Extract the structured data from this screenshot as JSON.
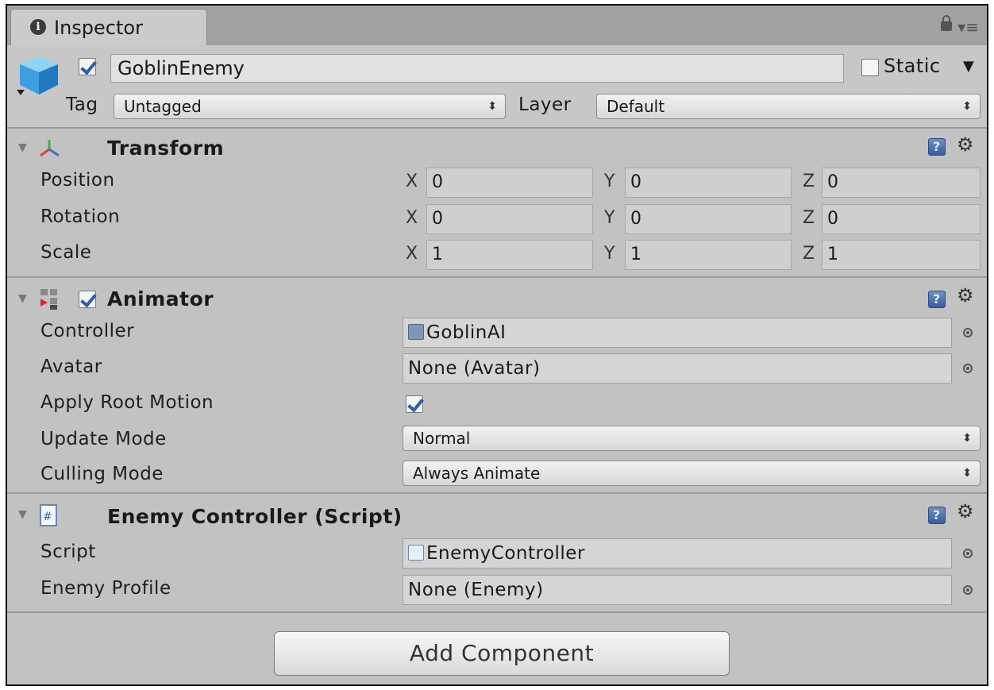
{
  "window": {
    "tab_label": "Inspector"
  },
  "header": {
    "object_name": "GoblinEnemy",
    "active": true,
    "static_label": "Static",
    "static_checked": false,
    "tag_label": "Tag",
    "tag_value": "Untagged",
    "layer_label": "Layer",
    "layer_value": "Default"
  },
  "transform": {
    "title": "Transform",
    "rows": [
      {
        "label": "Position",
        "x": "0",
        "y": "0",
        "z": "0"
      },
      {
        "label": "Rotation",
        "x": "0",
        "y": "0",
        "z": "0"
      },
      {
        "label": "Scale",
        "x": "1",
        "y": "1",
        "z": "1"
      }
    ],
    "axis": {
      "x": "X",
      "y": "Y",
      "z": "Z"
    }
  },
  "animator": {
    "title": "Animator",
    "enabled": true,
    "controller_label": "Controller",
    "controller_value": "GoblinAI",
    "avatar_label": "Avatar",
    "avatar_value": "None (Avatar)",
    "apply_root_motion_label": "Apply Root Motion",
    "apply_root_motion": true,
    "update_mode_label": "Update Mode",
    "update_mode_value": "Normal",
    "culling_mode_label": "Culling Mode",
    "culling_mode_value": "Always Animate"
  },
  "enemy_controller": {
    "title": "Enemy Controller (Script)",
    "script_label": "Script",
    "script_value": "EnemyController",
    "profile_label": "Enemy Profile",
    "profile_value": "None (Enemy)"
  },
  "footer": {
    "add_component_label": "Add Component"
  },
  "colors": {
    "panel_bg": "#c2c2c2",
    "titlebar_bg": "#a2a2a2",
    "check_blue": "#2d5fa8",
    "help_blue": "#3a5d9a"
  }
}
